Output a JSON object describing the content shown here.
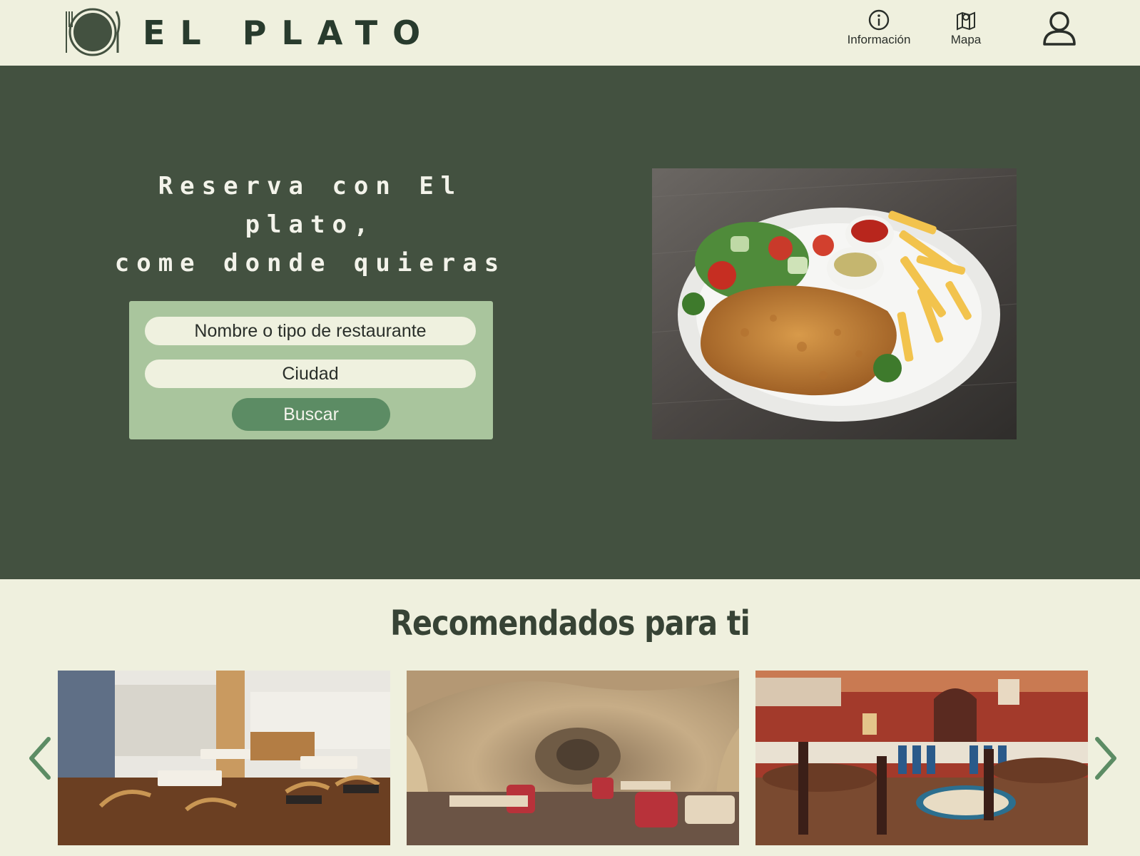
{
  "header": {
    "brand": "EL PLATO",
    "nav": [
      {
        "label": "Información",
        "icon": "info-icon"
      },
      {
        "label": "Mapa",
        "icon": "map-icon"
      }
    ],
    "account_icon": "user-icon"
  },
  "hero": {
    "headline_line1": "Reserva con El plato,",
    "headline_line2": "come donde quieras",
    "search": {
      "name_placeholder": "Nombre o tipo de restaurante",
      "city_placeholder": "Ciudad",
      "button_label": "Buscar"
    }
  },
  "recommended": {
    "title": "Recomendados para ti",
    "prev_icon": "chevron-left-icon",
    "next_icon": "chevron-right-icon"
  },
  "colors": {
    "background": "#eff0de",
    "hero": "#435140",
    "search_panel": "#a9c59d",
    "button": "#5c8c64",
    "brand_text": "#283b2d"
  }
}
